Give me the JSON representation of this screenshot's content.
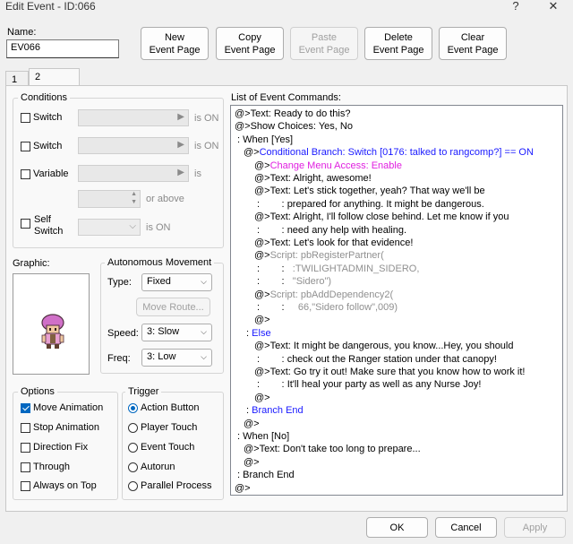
{
  "window": {
    "title": "Edit Event - ID:066",
    "help": "?",
    "close": "✕"
  },
  "name": {
    "label": "Name:",
    "value": "EV066"
  },
  "toolbar": [
    {
      "label": [
        "New",
        "Event Page"
      ],
      "enabled": true
    },
    {
      "label": [
        "Copy",
        "Event Page"
      ],
      "enabled": true
    },
    {
      "label": [
        "Paste",
        "Event Page"
      ],
      "enabled": false
    },
    {
      "label": [
        "Delete",
        "Event Page"
      ],
      "enabled": true
    },
    {
      "label": [
        "Clear",
        "Event Page"
      ],
      "enabled": true
    }
  ],
  "tabs": [
    "1",
    "2"
  ],
  "conditions": {
    "title": "Conditions",
    "switch1": {
      "label": "Switch",
      "suffix": "is ON"
    },
    "switch2": {
      "label": "Switch",
      "suffix": "is ON"
    },
    "variable": {
      "label": "Variable",
      "suffix": "is",
      "above": "or above"
    },
    "self_switch": {
      "label1": "Self",
      "label2": "Switch",
      "suffix": "is ON"
    }
  },
  "graphic": {
    "label": "Graphic:"
  },
  "autonomous": {
    "title": "Autonomous Movement",
    "type_label": "Type:",
    "type_value": "Fixed",
    "move_route": "Move Route...",
    "speed_label": "Speed:",
    "speed_value": "3: Slow",
    "freq_label": "Freq:",
    "freq_value": "3: Low"
  },
  "options": {
    "title": "Options",
    "items": [
      {
        "label": "Move Animation",
        "checked": true
      },
      {
        "label": "Stop Animation",
        "checked": false
      },
      {
        "label": "Direction Fix",
        "checked": false
      },
      {
        "label": "Through",
        "checked": false
      },
      {
        "label": "Always on Top",
        "checked": false
      }
    ]
  },
  "trigger": {
    "title": "Trigger",
    "items": [
      {
        "label": "Action Button",
        "checked": true
      },
      {
        "label": "Player Touch",
        "checked": false
      },
      {
        "label": "Event Touch",
        "checked": false
      },
      {
        "label": "Autorun",
        "checked": false
      },
      {
        "label": "Parallel Process",
        "checked": false
      }
    ]
  },
  "commands": {
    "label": "List of Event Commands:",
    "lines": [
      {
        "prefix": "@>",
        "text": "Text: Ready to do this?",
        "indent": 0,
        "color": ""
      },
      {
        "prefix": "@>",
        "text": "Show Choices: Yes, No",
        "indent": 0,
        "color": ""
      },
      {
        "prefix": " : ",
        "text": "When [Yes]",
        "indent": 0,
        "color": ""
      },
      {
        "prefix": "@>",
        "text": "Conditional Branch: Switch [0176: talked to rangcomp?] == ON",
        "indent": 1,
        "color": "blue"
      },
      {
        "prefix": "@>",
        "text": "Change Menu Access: Enable",
        "indent": 2,
        "color": "mag"
      },
      {
        "prefix": "@>",
        "text": "Text: Alright, awesome!",
        "indent": 2,
        "color": ""
      },
      {
        "prefix": "@>",
        "text": "Text: Let's stick together, yeah? That way we'll be",
        "indent": 2,
        "color": ""
      },
      {
        "prefix": " :        : ",
        "text": "prepared for anything. It might be dangerous.",
        "indent": 2,
        "color": ""
      },
      {
        "prefix": "@>",
        "text": "Text: Alright, I'll follow close behind. Let me know if you",
        "indent": 2,
        "color": ""
      },
      {
        "prefix": " :        : ",
        "text": "need any help with healing.",
        "indent": 2,
        "color": ""
      },
      {
        "prefix": "@>",
        "text": "Text: Let's look for that evidence!",
        "indent": 2,
        "color": ""
      },
      {
        "prefix": "@>",
        "text": "Script: pbRegisterPartner(",
        "indent": 2,
        "color": "grey"
      },
      {
        "prefix": " :        : ",
        "text": "  :TWILIGHTADMIN_SIDERO,",
        "indent": 2,
        "color": "grey"
      },
      {
        "prefix": " :        : ",
        "text": "  \"Sidero\")",
        "indent": 2,
        "color": "grey"
      },
      {
        "prefix": "@>",
        "text": "Script: pbAddDependency2(",
        "indent": 2,
        "color": "grey"
      },
      {
        "prefix": " :        : ",
        "text": "    66,\"Sidero follow\",009)",
        "indent": 2,
        "color": "grey"
      },
      {
        "prefix": "@>",
        "text": "",
        "indent": 2,
        "color": ""
      },
      {
        "prefix": " : ",
        "text": "Else",
        "indent": 1,
        "color": "blue"
      },
      {
        "prefix": "@>",
        "text": "Text: It might be dangerous, you know...Hey, you should",
        "indent": 2,
        "color": ""
      },
      {
        "prefix": " :        : ",
        "text": "check out the Ranger station under that canopy!",
        "indent": 2,
        "color": ""
      },
      {
        "prefix": "@>",
        "text": "Text: Go try it out! Make sure that you know how to work it!",
        "indent": 2,
        "color": ""
      },
      {
        "prefix": " :        : ",
        "text": "It'll heal your party as well as any Nurse Joy!",
        "indent": 2,
        "color": ""
      },
      {
        "prefix": "@>",
        "text": "",
        "indent": 2,
        "color": ""
      },
      {
        "prefix": " : ",
        "text": "Branch End",
        "indent": 1,
        "color": "blue"
      },
      {
        "prefix": "@>",
        "text": "",
        "indent": 1,
        "color": ""
      },
      {
        "prefix": " : ",
        "text": "When [No]",
        "indent": 0,
        "color": ""
      },
      {
        "prefix": "@>",
        "text": "Text: Don't take too long to prepare...",
        "indent": 1,
        "color": ""
      },
      {
        "prefix": "@>",
        "text": "",
        "indent": 1,
        "color": ""
      },
      {
        "prefix": " : ",
        "text": "Branch End",
        "indent": 0,
        "color": ""
      },
      {
        "prefix": "@>",
        "text": "",
        "indent": -1,
        "color": ""
      }
    ]
  },
  "footer": {
    "ok": "OK",
    "cancel": "Cancel",
    "apply": "Apply"
  }
}
